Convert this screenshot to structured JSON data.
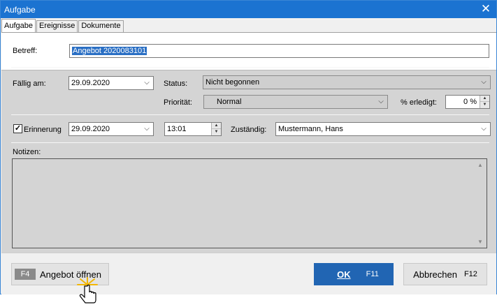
{
  "window": {
    "title": "Aufgabe"
  },
  "tabs": [
    {
      "label": "Aufgabe"
    },
    {
      "label": "Ereignisse"
    },
    {
      "label": "Dokumente"
    }
  ],
  "betreff": {
    "label": "Betreff:",
    "value": "Angebot 2020083101"
  },
  "faellig": {
    "label": "Fällig am:",
    "value": "29.09.2020"
  },
  "status": {
    "label": "Status:",
    "value": "Nicht begonnen"
  },
  "prioritaet": {
    "label": "Priorität:",
    "value": "Normal"
  },
  "erledigt": {
    "label": "% erledigt:",
    "value": "0 %"
  },
  "erinnerung": {
    "label": "Erinnerung",
    "checked": true,
    "date": "29.09.2020",
    "time": "13:01"
  },
  "zustaendig": {
    "label": "Zuständig:",
    "value": "Mustermann, Hans"
  },
  "notizen": {
    "label": "Notizen:"
  },
  "buttons": {
    "angebot": {
      "key": "F4",
      "label": "Angebot öffnen"
    },
    "ok": {
      "label": "OK",
      "key": "F11"
    },
    "abbrechen": {
      "label": "Abbrechen",
      "key": "F12"
    }
  },
  "colors": {
    "titlebar": "#1b73d1",
    "ok_button": "#2165b3",
    "selection": "#2a6fc4"
  }
}
